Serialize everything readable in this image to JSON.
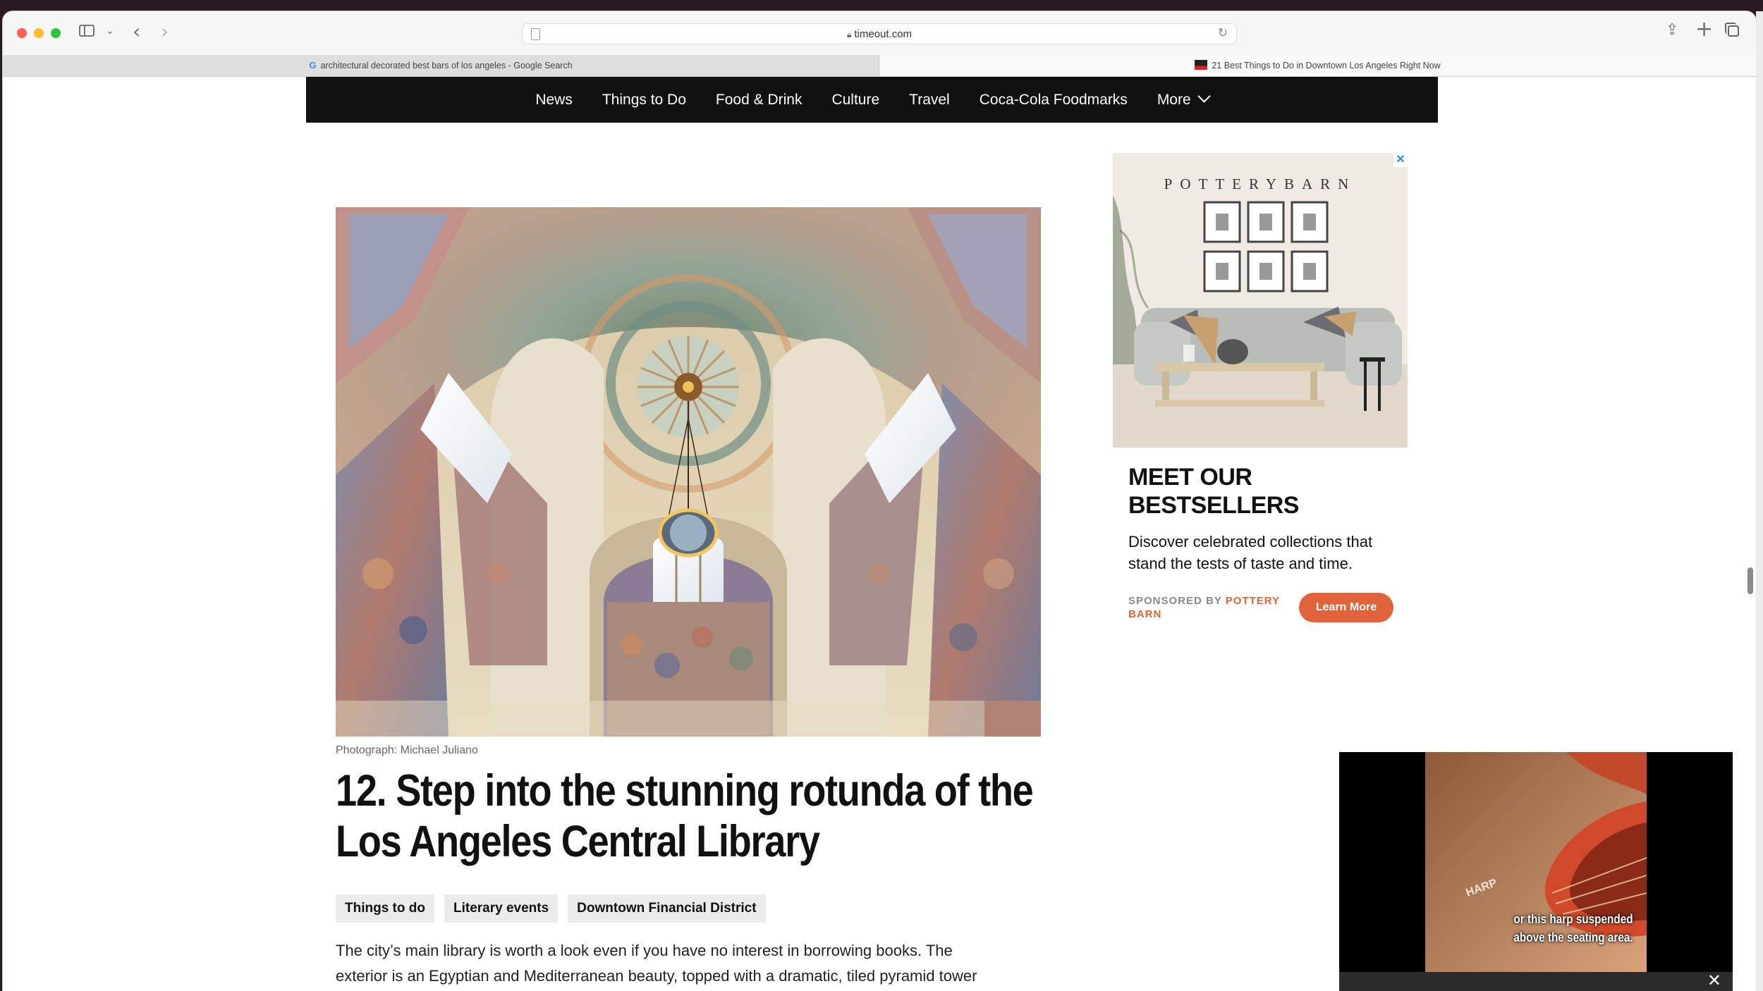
{
  "browser": {
    "url": "timeout.com",
    "tabs": [
      {
        "title": "architectural decorated best bars of los angeles - Google Search",
        "active": false
      },
      {
        "title": "21 Best Things to Do in Downtown Los Angeles Right Now",
        "active": true
      }
    ]
  },
  "nav": {
    "items": [
      "News",
      "Things to Do",
      "Food & Drink",
      "Culture",
      "Travel",
      "Coca-Cola Foodmarks"
    ],
    "more_label": "More"
  },
  "article": {
    "photo_credit": "Photograph: Michael Juliano",
    "headline": "12. Step into the stunning rotunda of the Los Angeles Central Library",
    "tags": [
      "Things to do",
      "Literary events",
      "Downtown Financial District"
    ],
    "body": "The city’s main library is worth a look even if you have no interest in borrowing books. The exterior is an Egyptian and Mediterranean beauty, topped with a dramatic, tiled pyramid tower and decorated with bas reliefs. The most stunning features, though, reside in the second floor"
  },
  "ad": {
    "brand_logo": "POTTERYBARN",
    "title": "MEET OUR BESTSELLERS",
    "description": "Discover celebrated collections that stand the tests of taste and time.",
    "sponsored_prefix": "SPONSORED BY",
    "sponsor": "POTTERY BARN",
    "button_label": "Learn More",
    "close_glyph": "✕"
  },
  "video": {
    "sign_text": "HARP",
    "caption": "or this harp suspended above the seating area.",
    "close_glyph": "✕"
  },
  "colors": {
    "nav_bg": "#111111",
    "ad_accent": "#e0633b",
    "tag_bg": "#ececec"
  }
}
